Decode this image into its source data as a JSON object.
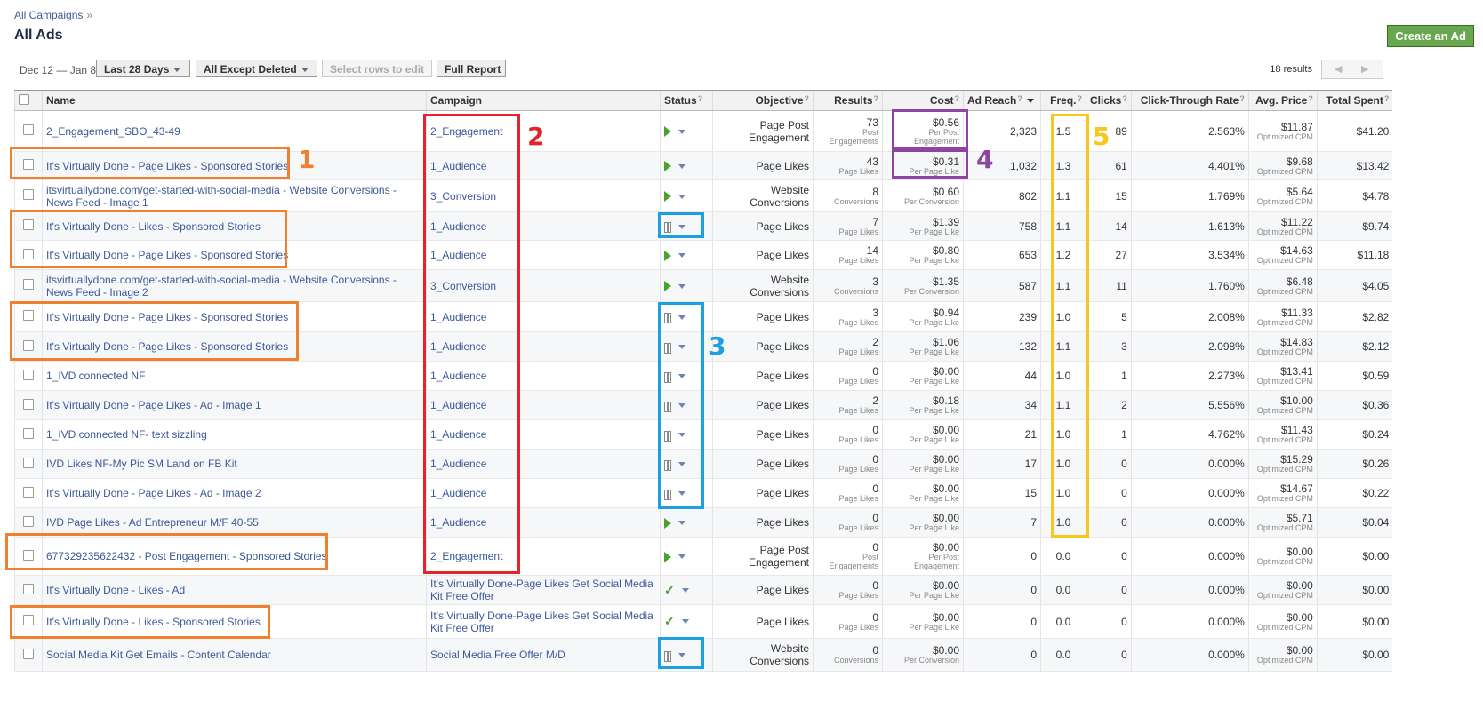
{
  "breadcrumb": {
    "label": "All Campaigns",
    "sep": "»"
  },
  "page_title": "All Ads",
  "create_button": "Create an Ad",
  "toolbar": {
    "date_range": "Dec 12 — Jan 8",
    "period": "Last 28 Days",
    "filter": "All Except Deleted",
    "select_rows": "Select rows to edit",
    "full_report": "Full Report",
    "results_count": "18 results",
    "prev": "◀",
    "next": "▶"
  },
  "columns": {
    "name": "Name",
    "campaign": "Campaign",
    "status": "Status",
    "objective": "Objective",
    "results": "Results",
    "cost": "Cost",
    "reach": "Ad Reach",
    "freq": "Freq.",
    "clicks": "Clicks",
    "ctr": "Click-Through Rate",
    "avg_price": "Avg. Price",
    "spent": "Total Spent",
    "help": "?"
  },
  "rows": [
    {
      "name": "2_Engagement_SBO_43-49",
      "campaign": "2_Engagement",
      "status": "active",
      "objective": "Page Post Engagement",
      "results": "73",
      "results_sub": "Post Engagements",
      "cost": "$0.56",
      "cost_sub": "Per Post Engagement",
      "reach": "2,323",
      "freq": "1.5",
      "clicks": "89",
      "ctr": "2.563%",
      "price": "$11.87",
      "price_sub": "Optimized CPM",
      "spent": "$41.20"
    },
    {
      "name": "It's Virtually Done - Page Likes - Sponsored Stories",
      "campaign": "1_Audience",
      "status": "active",
      "objective": "Page Likes",
      "results": "43",
      "results_sub": "Page Likes",
      "cost": "$0.31",
      "cost_sub": "Per Page Like",
      "reach": "1,032",
      "freq": "1.3",
      "clicks": "61",
      "ctr": "4.401%",
      "price": "$9.68",
      "price_sub": "Optimized CPM",
      "spent": "$13.42"
    },
    {
      "name": "itsvirtuallydone.com/get-started-with-social-media - Website Conversions - News Feed - Image 1",
      "campaign": "3_Conversion",
      "status": "active",
      "objective": "Website Conversions",
      "results": "8",
      "results_sub": "Conversions",
      "cost": "$0.60",
      "cost_sub": "Per Conversion",
      "reach": "802",
      "freq": "1.1",
      "clicks": "15",
      "ctr": "1.769%",
      "price": "$5.64",
      "price_sub": "Optimized CPM",
      "spent": "$4.78"
    },
    {
      "name": "It's Virtually Done - Likes - Sponsored Stories",
      "campaign": "1_Audience",
      "status": "paused",
      "objective": "Page Likes",
      "results": "7",
      "results_sub": "Page Likes",
      "cost": "$1.39",
      "cost_sub": "Per Page Like",
      "reach": "758",
      "freq": "1.1",
      "clicks": "14",
      "ctr": "1.613%",
      "price": "$11.22",
      "price_sub": "Optimized CPM",
      "spent": "$9.74"
    },
    {
      "name": "It's Virtually Done - Page Likes - Sponsored Stories",
      "campaign": "1_Audience",
      "status": "active",
      "objective": "Page Likes",
      "results": "14",
      "results_sub": "Page Likes",
      "cost": "$0.80",
      "cost_sub": "Per Page Like",
      "reach": "653",
      "freq": "1.2",
      "clicks": "27",
      "ctr": "3.534%",
      "price": "$14.63",
      "price_sub": "Optimized CPM",
      "spent": "$11.18"
    },
    {
      "name": "itsvirtuallydone.com/get-started-with-social-media - Website Conversions - News Feed - Image 2",
      "campaign": "3_Conversion",
      "status": "active",
      "objective": "Website Conversions",
      "results": "3",
      "results_sub": "Conversions",
      "cost": "$1.35",
      "cost_sub": "Per Conversion",
      "reach": "587",
      "freq": "1.1",
      "clicks": "11",
      "ctr": "1.760%",
      "price": "$6.48",
      "price_sub": "Optimized CPM",
      "spent": "$4.05"
    },
    {
      "name": "It's Virtually Done - Page Likes - Sponsored Stories",
      "campaign": "1_Audience",
      "status": "paused",
      "objective": "Page Likes",
      "results": "3",
      "results_sub": "Page Likes",
      "cost": "$0.94",
      "cost_sub": "Per Page Like",
      "reach": "239",
      "freq": "1.0",
      "clicks": "5",
      "ctr": "2.008%",
      "price": "$11.33",
      "price_sub": "Optimized CPM",
      "spent": "$2.82"
    },
    {
      "name": "It's Virtually Done - Page Likes - Sponsored Stories",
      "campaign": "1_Audience",
      "status": "paused",
      "objective": "Page Likes",
      "results": "2",
      "results_sub": "Page Likes",
      "cost": "$1.06",
      "cost_sub": "Per Page Like",
      "reach": "132",
      "freq": "1.1",
      "clicks": "3",
      "ctr": "2.098%",
      "price": "$14.83",
      "price_sub": "Optimized CPM",
      "spent": "$2.12"
    },
    {
      "name": "1_IVD connected NF",
      "campaign": "1_Audience",
      "status": "paused",
      "objective": "Page Likes",
      "results": "0",
      "results_sub": "Page Likes",
      "cost": "$0.00",
      "cost_sub": "Per Page Like",
      "reach": "44",
      "freq": "1.0",
      "clicks": "1",
      "ctr": "2.273%",
      "price": "$13.41",
      "price_sub": "Optimized CPM",
      "spent": "$0.59"
    },
    {
      "name": "It's Virtually Done - Page Likes - Ad - Image 1",
      "campaign": "1_Audience",
      "status": "paused",
      "objective": "Page Likes",
      "results": "2",
      "results_sub": "Page Likes",
      "cost": "$0.18",
      "cost_sub": "Per Page Like",
      "reach": "34",
      "freq": "1.1",
      "clicks": "2",
      "ctr": "5.556%",
      "price": "$10.00",
      "price_sub": "Optimized CPM",
      "spent": "$0.36"
    },
    {
      "name": "1_IVD connected NF- text sizzling",
      "campaign": "1_Audience",
      "status": "paused",
      "objective": "Page Likes",
      "results": "0",
      "results_sub": "Page Likes",
      "cost": "$0.00",
      "cost_sub": "Per Page Like",
      "reach": "21",
      "freq": "1.0",
      "clicks": "1",
      "ctr": "4.762%",
      "price": "$11.43",
      "price_sub": "Optimized CPM",
      "spent": "$0.24"
    },
    {
      "name": "IVD Likes NF-My Pic SM Land on FB Kit",
      "campaign": "1_Audience",
      "status": "paused",
      "objective": "Page Likes",
      "results": "0",
      "results_sub": "Page Likes",
      "cost": "$0.00",
      "cost_sub": "Per Page Like",
      "reach": "17",
      "freq": "1.0",
      "clicks": "0",
      "ctr": "0.000%",
      "price": "$15.29",
      "price_sub": "Optimized CPM",
      "spent": "$0.26"
    },
    {
      "name": "It's Virtually Done - Page Likes - Ad - Image 2",
      "campaign": "1_Audience",
      "status": "paused",
      "objective": "Page Likes",
      "results": "0",
      "results_sub": "Page Likes",
      "cost": "$0.00",
      "cost_sub": "Per Page Like",
      "reach": "15",
      "freq": "1.0",
      "clicks": "0",
      "ctr": "0.000%",
      "price": "$14.67",
      "price_sub": "Optimized CPM",
      "spent": "$0.22"
    },
    {
      "name": "IVD Page Likes - Ad Entrepreneur M/F 40-55",
      "campaign": "1_Audience",
      "status": "active",
      "objective": "Page Likes",
      "results": "0",
      "results_sub": "Page Likes",
      "cost": "$0.00",
      "cost_sub": "Per Page Like",
      "reach": "7",
      "freq": "1.0",
      "clicks": "0",
      "ctr": "0.000%",
      "price": "$5.71",
      "price_sub": "Optimized CPM",
      "spent": "$0.04"
    },
    {
      "name": "677329235622432 - Post Engagement - Sponsored Stories",
      "campaign": "2_Engagement",
      "status": "active",
      "objective": "Page Post Engagement",
      "results": "0",
      "results_sub": "Post Engagements",
      "cost": "$0.00",
      "cost_sub": "Per Post Engagement",
      "reach": "0",
      "freq": "0.0",
      "clicks": "0",
      "ctr": "0.000%",
      "price": "$0.00",
      "price_sub": "Optimized CPM",
      "spent": "$0.00"
    },
    {
      "name": "It's Virtually Done - Likes - Ad",
      "campaign": "It's Virtually Done-Page Likes Get Social Media Kit Free Offer",
      "status": "approved",
      "objective": "Page Likes",
      "results": "0",
      "results_sub": "Page Likes",
      "cost": "$0.00",
      "cost_sub": "Per Page Like",
      "reach": "0",
      "freq": "0.0",
      "clicks": "0",
      "ctr": "0.000%",
      "price": "$0.00",
      "price_sub": "Optimized CPM",
      "spent": "$0.00"
    },
    {
      "name": "It's Virtually Done - Likes - Sponsored Stories",
      "campaign": "It's Virtually Done-Page Likes Get Social Media Kit Free Offer",
      "status": "approved",
      "objective": "Page Likes",
      "results": "0",
      "results_sub": "Page Likes",
      "cost": "$0.00",
      "cost_sub": "Per Page Like",
      "reach": "0",
      "freq": "0.0",
      "clicks": "0",
      "ctr": "0.000%",
      "price": "$0.00",
      "price_sub": "Optimized CPM",
      "spent": "$0.00"
    },
    {
      "name": "Social Media Kit Get Emails - Content Calendar",
      "campaign": "Social Media Free Offer M/D",
      "status": "paused",
      "objective": "Website Conversions",
      "results": "0",
      "results_sub": "Conversions",
      "cost": "$0.00",
      "cost_sub": "Per Conversion",
      "reach": "0",
      "freq": "0.0",
      "clicks": "0",
      "ctr": "0.000%",
      "price": "$0.00",
      "price_sub": "Optimized CPM",
      "spent": "$0.00"
    }
  ],
  "markers": [
    "1",
    "2",
    "3",
    "4",
    "5"
  ],
  "colors": {
    "orange": "#f07f2e",
    "red": "#e0262b",
    "blue": "#1e9fe0",
    "purple": "#8e44a0",
    "yellow": "#f7c71f"
  }
}
